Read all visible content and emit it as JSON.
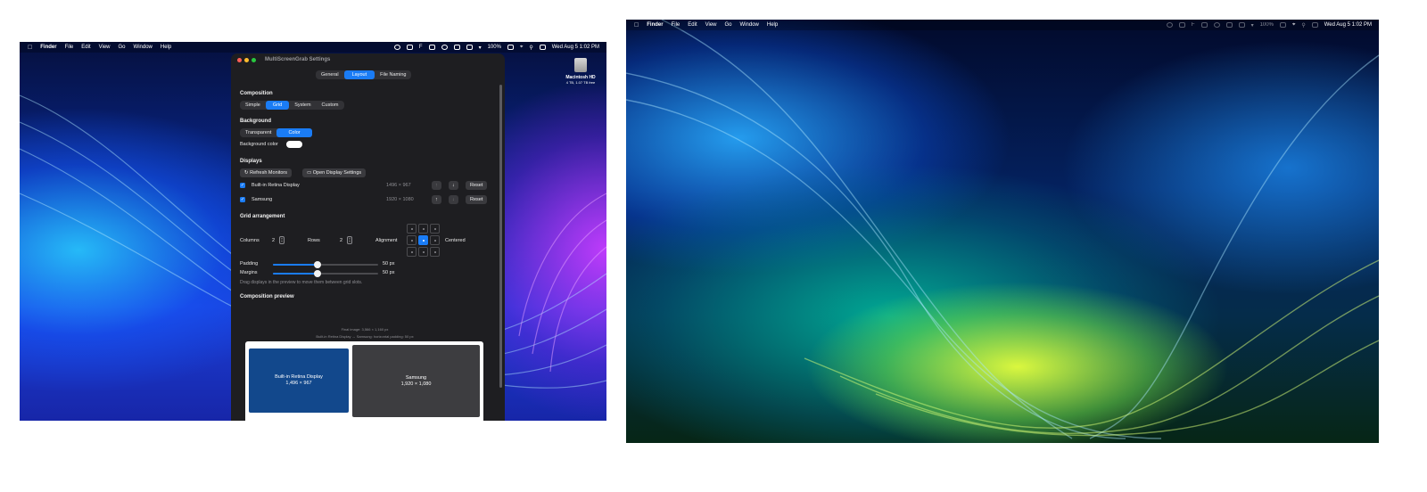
{
  "menubar": {
    "app": "Finder",
    "items": [
      "File",
      "Edit",
      "View",
      "Go",
      "Window",
      "Help"
    ],
    "battery": "100%",
    "datetime": "Wed Aug 5  1:02 PM"
  },
  "desktop_icon": {
    "name": "Macintosh HD",
    "subtitle": "4 TB, 1.07 TB free"
  },
  "window": {
    "title": "MultiScreenGrab Settings",
    "tabs": [
      "General",
      "Layout",
      "File Naming"
    ],
    "active_tab": "Layout",
    "composition": {
      "heading": "Composition",
      "options": [
        "Simple",
        "Grid",
        "System",
        "Custom"
      ],
      "selected": "Grid"
    },
    "background": {
      "heading": "Background",
      "options": [
        "Transparent",
        "Color"
      ],
      "selected": "Color",
      "color_label": "Background color",
      "color_value": "#ffffff"
    },
    "displays": {
      "heading": "Displays",
      "refresh_label": "Refresh Monitors",
      "open_settings_label": "Open Display Settings",
      "reset_label": "Reset",
      "rows": [
        {
          "name": "Built-in Retina Display",
          "resolution": "1496 × 967",
          "checked": true
        },
        {
          "name": "Samsung",
          "resolution": "1920 × 1080",
          "checked": true
        }
      ]
    },
    "grid": {
      "heading": "Grid arrangement",
      "columns_label": "Columns",
      "columns": "2",
      "rows_label": "Rows",
      "rows": "2",
      "alignment_label": "Alignment",
      "alignment_value": "Centered",
      "padding_label": "Padding",
      "padding_value": "50 px",
      "padding_level": 0.42,
      "margins_label": "Margins",
      "margins_value": "50 px",
      "margins_level": 0.42,
      "hint": "Drag displays in the preview to move them between grid slots."
    },
    "preview": {
      "heading": "Composition preview",
      "final_image": "Final image: 3,566 × 1,160 px",
      "relation": "Built-in Retina Display ↔ Samsung: horizontal padding: 50 px",
      "display1": {
        "name": "Built-in Retina Display",
        "res": "1,496 × 967"
      },
      "display2": {
        "name": "Samsung",
        "res": "1,920 × 1,080"
      }
    }
  }
}
